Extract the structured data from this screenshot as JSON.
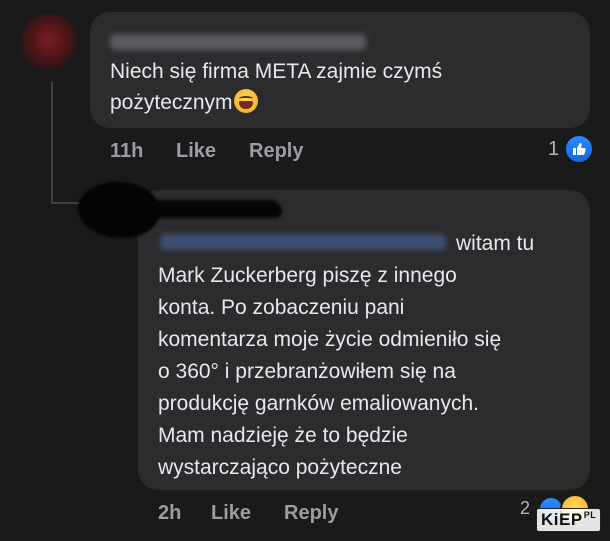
{
  "comment": {
    "text": "Niech się firma META zajmie czymś\npożytecznym",
    "emoji": "tears-of-joy",
    "time": "11h",
    "like_label": "Like",
    "reply_label": "Reply",
    "reaction_count": "1"
  },
  "reply": {
    "first_line_suffix": "witam tu",
    "text": "Mark Zuckerberg piszę z innego\nkonta. Po zobaczeniu pani\nkomentarza moje życie odmieniło się\no 360° i przebranżowiłem się na\nprodukcję garnków emaliowanych.\nMam nadzieję że to będzie\nwystarczająco pożyteczne",
    "time": "2h",
    "like_label": "Like",
    "reply_label": "Reply",
    "reaction_count": "2"
  },
  "watermark": {
    "brand": "KiEP",
    "suffix": "PL"
  },
  "colors": {
    "background": "#1a1a1b",
    "bubble": "#2c2c2e",
    "like_blue": "#1877f2",
    "meta_text": "#9a9da3"
  }
}
